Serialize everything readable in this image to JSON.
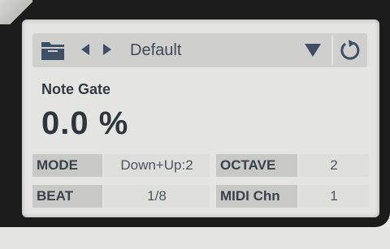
{
  "preset": {
    "name": "Default"
  },
  "parameter": {
    "label": "Note Gate",
    "value": "0.0 %"
  },
  "grid": {
    "mode_label": "MODE",
    "mode_value": "Down+Up:2",
    "octave_label": "OCTAVE",
    "octave_value": "2",
    "beat_label": "BEAT",
    "beat_value": "1/8",
    "midi_label": "MIDI Chn",
    "midi_value": "1"
  },
  "icons": {
    "folder": "folder-icon",
    "prev": "arrow-left-icon",
    "next": "arrow-right-icon",
    "dropdown": "dropdown-icon",
    "reset": "reset-icon"
  },
  "colors": {
    "screen_bg": "#e4e4e2",
    "toolbar_bg": "#cfcfcd",
    "label_cell_bg": "#c8c8c6",
    "text_dark": "#2e353b",
    "icon_color": "#3f4f63"
  }
}
